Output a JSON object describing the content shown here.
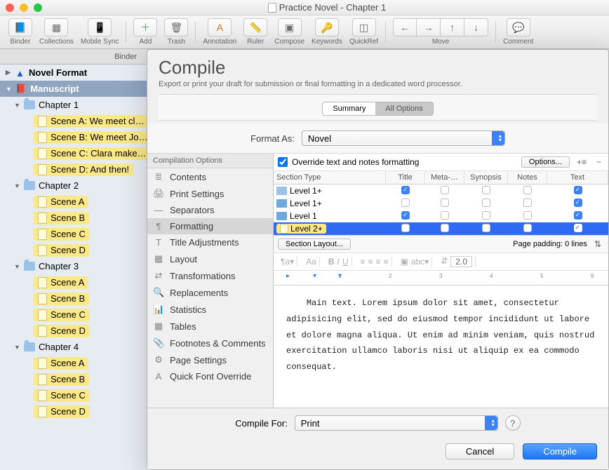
{
  "window_title": "Practice Novel - Chapter 1",
  "toolbar": {
    "binder": "Binder",
    "collections": "Collections",
    "mobile": "Mobile Sync",
    "add": "Add",
    "trash": "Trash",
    "annotation": "Annotation",
    "ruler": "Ruler",
    "compose": "Compose",
    "keywords": "Keywords",
    "quickref": "QuickRef",
    "move": "Move",
    "comment": "Comment"
  },
  "tabstrip": {
    "tab": "Binder"
  },
  "binder": {
    "root": "Novel Format",
    "manuscript": "Manuscript",
    "chapters": [
      {
        "title": "Chapter 1",
        "scenes": [
          "Scene A: We meet cl…",
          "Scene B: We meet Jo…",
          "Scene C: Clara make…",
          "Scene D: And then!"
        ]
      },
      {
        "title": "Chapter 2",
        "scenes": [
          "Scene A",
          "Scene B",
          "Scene C",
          "Scene D"
        ]
      },
      {
        "title": "Chapter 3",
        "scenes": [
          "Scene A",
          "Scene B",
          "Scene C",
          "Scene D"
        ]
      },
      {
        "title": "Chapter 4",
        "scenes": [
          "Scene A",
          "Scene B",
          "Scene C",
          "Scene D"
        ]
      }
    ]
  },
  "sheet": {
    "title": "Compile",
    "subtitle": "Export or print your draft for submission or final formatting in a dedicated word processor.",
    "seg_summary": "Summary",
    "seg_all": "All Options",
    "format_as_label": "Format As:",
    "format_as_value": "Novel",
    "side_header": "Compilation Options",
    "side_items": [
      "Contents",
      "Print Settings",
      "Separators",
      "Formatting",
      "Title Adjustments",
      "Layout",
      "Transformations",
      "Replacements",
      "Statistics",
      "Tables",
      "Footnotes & Comments",
      "Page Settings",
      "Quick Font Override"
    ],
    "override_label": "Override text and notes formatting",
    "options_btn": "Options...",
    "cols": {
      "type": "Section Type",
      "title": "Title",
      "meta": "Meta-…",
      "syn": "Synopsis",
      "notes": "Notes",
      "text": "Text"
    },
    "levels": [
      {
        "icon": "folder",
        "label": "Level  1+",
        "title": true,
        "text": true
      },
      {
        "icon": "folder2",
        "label": "Level  1+",
        "title": false,
        "text": true
      },
      {
        "icon": "folder2",
        "label": "Level  1",
        "title": true,
        "text": true
      },
      {
        "icon": "doc",
        "label": "Level  2+",
        "title": false,
        "text": true,
        "selected": true
      }
    ],
    "section_layout_btn": "Section Layout...",
    "page_padding_label": "Page padding: 0 lines",
    "line_spacing": "2.0",
    "preview_text": "Main text. Lorem ipsum dolor sit amet, consectetur adipisicing elit, sed do eiusmod tempor incididunt ut labore et dolore magna aliqua. Ut enim ad minim veniam, quis nostrud exercitation ullamco laboris nisi ut aliquip ex ea commodo consequat.",
    "compile_for_label": "Compile For:",
    "compile_for_value": "Print",
    "cancel": "Cancel",
    "compile": "Compile"
  }
}
